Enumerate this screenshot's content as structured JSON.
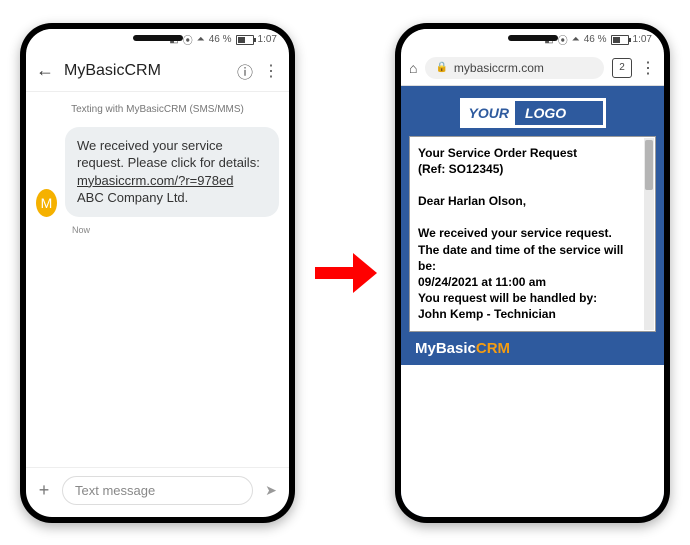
{
  "status": {
    "battery_text": "46 %",
    "time": "1:07"
  },
  "sms": {
    "app_title": "MyBasicCRM",
    "conversation_label": "Texting with MyBasicCRM (SMS/MMS)",
    "avatar_letter": "M",
    "message_prefix": "We received your service request. Please click for details: ",
    "message_link": "mybasiccrm.com/?r=978ed",
    "message_sender": "ABC Company Ltd.",
    "timestamp": "Now",
    "compose_placeholder": "Text message"
  },
  "browser": {
    "url": "mybasiccrm.com",
    "tab_count": "2"
  },
  "page": {
    "logo_part1": "YOUR",
    "logo_part2": "LOGO",
    "line1": "Your Service Order Request",
    "line2": "(Ref: SO12345)",
    "greeting": "Dear Harlan Olson,",
    "body1": "We received your service request.",
    "body2": "The date and time of the service will be:",
    "body3": "09/24/2021 at 11:00 am",
    "body4": "You request will be handled by:",
    "body5": "John Kemp - Technician",
    "footer_part1": "MyBasic",
    "footer_part2": "CRM"
  }
}
